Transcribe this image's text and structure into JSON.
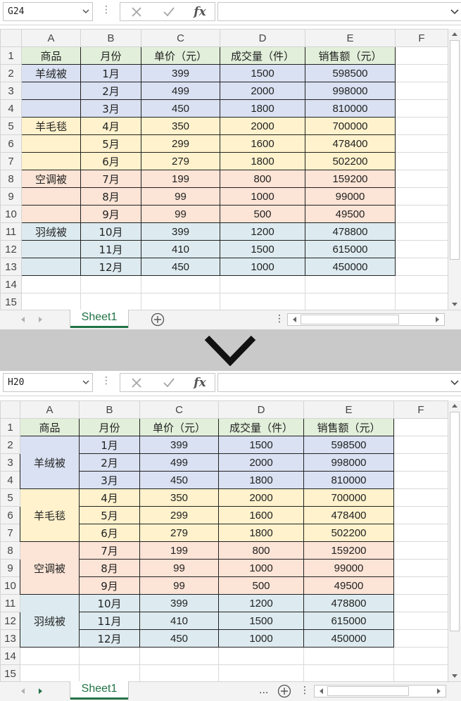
{
  "columns": [
    "A",
    "B",
    "C",
    "D",
    "E",
    "F"
  ],
  "row_numbers": [
    "1",
    "2",
    "3",
    "4",
    "5",
    "6",
    "7",
    "8",
    "9",
    "10",
    "11",
    "12",
    "13",
    "14",
    "15"
  ],
  "headers": [
    "商品",
    "月份",
    "单价（元）",
    "成交量（件）",
    "销售额（元）"
  ],
  "groups": [
    "羊绒被",
    "羊毛毯",
    "空调被",
    "羽绒被"
  ],
  "months": [
    "1月",
    "2月",
    "3月",
    "4月",
    "5月",
    "6月",
    "7月",
    "8月",
    "9月",
    "10月",
    "11月",
    "12月"
  ],
  "prices": [
    "399",
    "499",
    "450",
    "350",
    "299",
    "279",
    "199",
    "99",
    "99",
    "399",
    "410",
    "450"
  ],
  "volumes": [
    "1500",
    "2000",
    "1800",
    "2000",
    "1600",
    "1800",
    "800",
    "1000",
    "500",
    "1200",
    "1500",
    "1000"
  ],
  "sales": [
    "598500",
    "998000",
    "810000",
    "700000",
    "478400",
    "502200",
    "159200",
    "99000",
    "49500",
    "478800",
    "615000",
    "450000"
  ],
  "colors": {
    "header_fill": "#e2efda",
    "group_1_fill": "#d9e1f2",
    "group_2_fill": "#fff2cc",
    "group_3_fill": "#fce4d6",
    "group_4_fill": "#ddebf0",
    "sheet_tab_accent": "#217346",
    "separator": "#c9c9c9"
  },
  "top": {
    "name_box": "G24",
    "sheet_tab": "Sheet1"
  },
  "bottom": {
    "name_box": "H20",
    "sheet_tab": "Sheet1",
    "tab_overflow": "..."
  },
  "separator_icon": "chevron-down-icon",
  "formula_bar_icons": [
    "cancel-x-icon",
    "enter-check-icon",
    "function-fx-icon"
  ],
  "formula_bar_fx": "fx"
}
